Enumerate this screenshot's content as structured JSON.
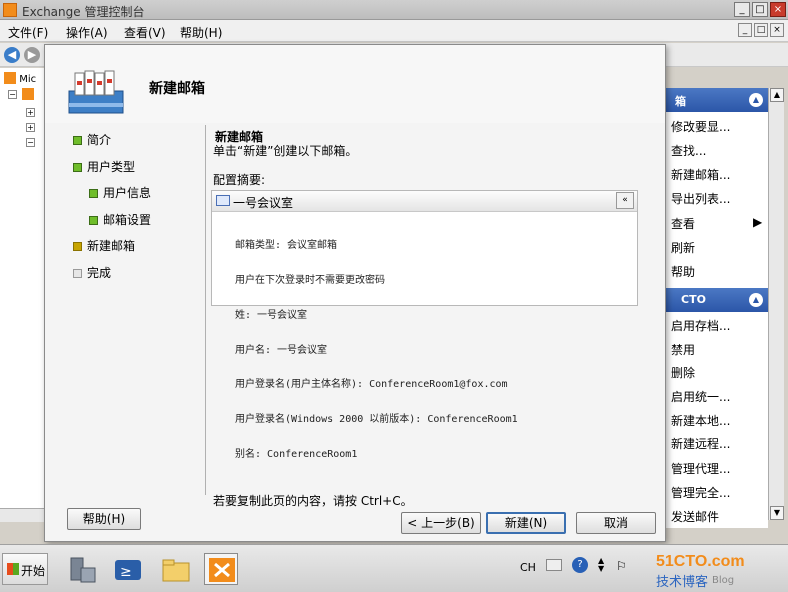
{
  "window": {
    "title": "Exchange 管理控制台",
    "minimize": "_",
    "maximize": "□",
    "close": "×"
  },
  "menu": {
    "items": [
      "文件(F)",
      "操作(A)",
      "查看(V)",
      "帮助(H)"
    ],
    "right_buttons": [
      "_",
      "□",
      "×"
    ]
  },
  "tree": {
    "root_label": "Mic",
    "expanders": [
      "−",
      "+",
      "+",
      "−"
    ]
  },
  "actions": {
    "header_1": "箱",
    "items_1": [
      "修改要显...",
      "查找...",
      "新建邮箱...",
      "导出列表...",
      "查看",
      "刷新",
      "帮助"
    ],
    "view_arrow": "▶",
    "header_2": "CTO",
    "items_2": [
      "启用存档...",
      "禁用",
      "删除",
      "启用统一...",
      "新建本地...",
      "新建远程...",
      "管理代理...",
      "管理完全...",
      "发送邮件"
    ],
    "collapse_glyph": "▲"
  },
  "dialog": {
    "title": "新建邮箱",
    "steps": [
      {
        "label": "简介",
        "state": "done",
        "indent": false
      },
      {
        "label": "用户类型",
        "state": "done",
        "indent": false
      },
      {
        "label": "用户信息",
        "state": "done",
        "indent": true
      },
      {
        "label": "邮箱设置",
        "state": "done",
        "indent": true
      },
      {
        "label": "新建邮箱",
        "state": "current",
        "indent": false
      },
      {
        "label": "完成",
        "state": "pending",
        "indent": false
      }
    ],
    "content_title": "新建邮箱",
    "content_desc": "单击“新建”创建以下邮箱。",
    "summary_label": "配置摘要:",
    "summary_name": "一号会议室",
    "summary_collapse": "«",
    "summary_lines": [
      "邮箱类型: 会议室邮箱",
      "用户在下次登录时不需要更改密码",
      "姓: 一号会议室",
      "用户名: 一号会议室",
      "用户登录名(用户主体名称): ConferenceRoom1@fox.com",
      "用户登录名(Windows 2000 以前版本): ConferenceRoom1",
      "别名: ConferenceRoom1"
    ],
    "copy_hint": "若要复制此页的内容，请按 Ctrl+C。",
    "buttons": {
      "help": "帮助(H)",
      "back": "< 上一步(B)",
      "new": "新建(N)",
      "cancel": "取消"
    }
  },
  "taskbar": {
    "start": "开始",
    "lang": "CH",
    "help_glyph": "?"
  },
  "watermark": {
    "site": "51CTO.com",
    "tag1": "技术博客",
    "tag2": "Blog"
  }
}
